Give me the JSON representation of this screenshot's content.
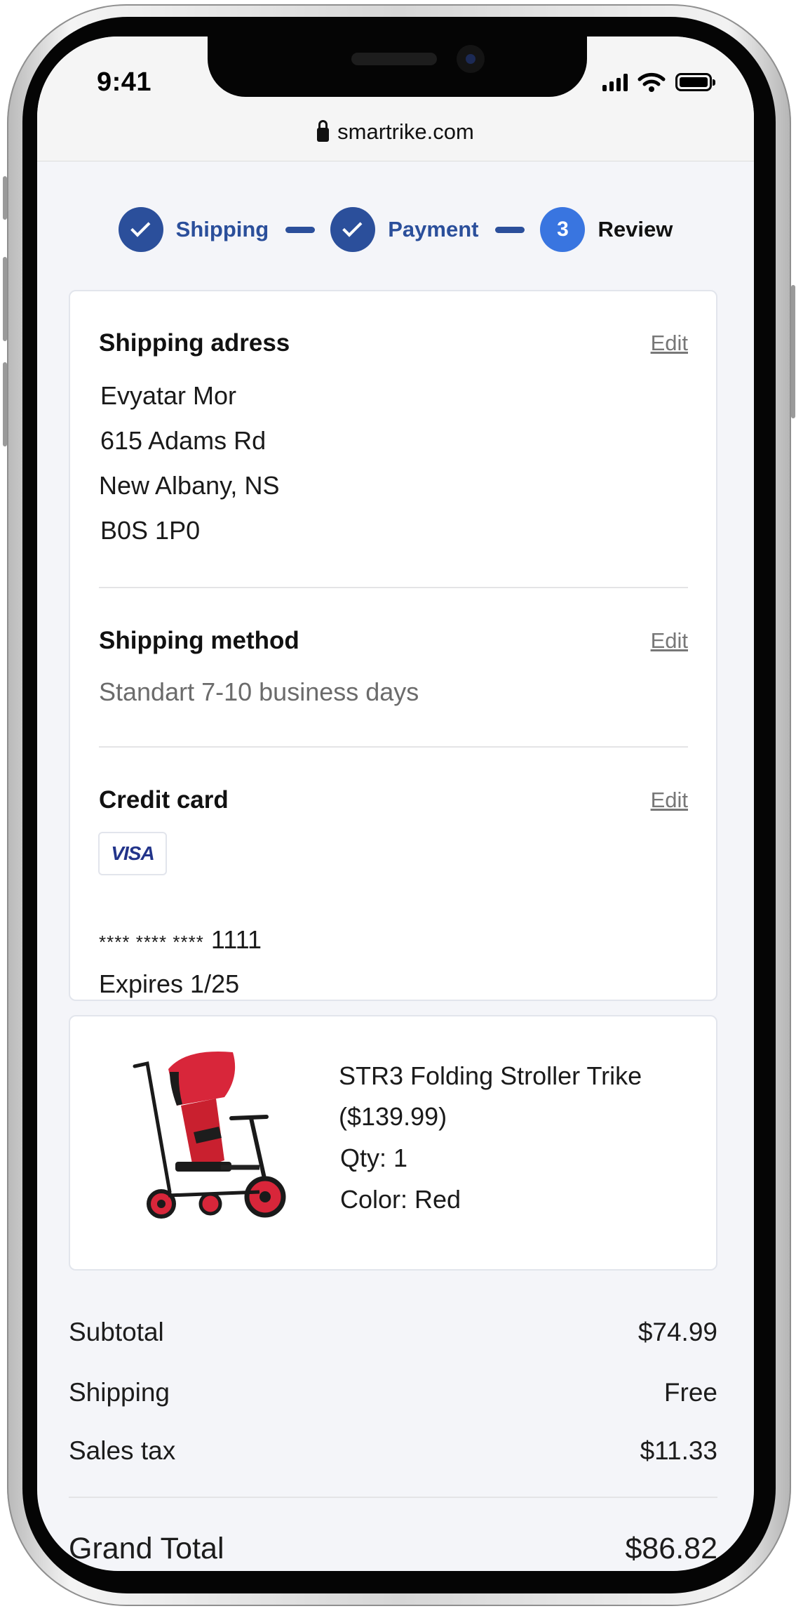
{
  "status": {
    "time": "9:41"
  },
  "browser": {
    "url": "smartrike.com"
  },
  "steps": [
    {
      "label": "Shipping",
      "state": "done"
    },
    {
      "label": "Payment",
      "state": "done"
    },
    {
      "number": "3",
      "label": "Review",
      "state": "current"
    }
  ],
  "shipping_address": {
    "title": "Shipping adress",
    "edit": "Edit",
    "lines": [
      "Evyatar Mor",
      "615 Adams Rd",
      "New Albany, NS",
      "B0S 1P0"
    ]
  },
  "shipping_method": {
    "title": "Shipping method",
    "edit": "Edit",
    "value": "Standart 7-10 business days"
  },
  "credit_card": {
    "title": "Credit card",
    "edit": "Edit",
    "brand": "VISA",
    "masked": "**** **** ****",
    "last4": "1111",
    "expires": "Expires 1/25"
  },
  "product": {
    "name": "STR3 Folding Stroller Trike",
    "price": "($139.99)",
    "qty": "Qty: 1",
    "color": "Color: Red",
    "image_icon": "tricycle-image"
  },
  "totals": {
    "subtotal_label": "Subtotal",
    "subtotal": "$74.99",
    "shipping_label": "Shipping",
    "shipping": "Free",
    "tax_label": "Sales tax",
    "tax": "$11.33",
    "grand_label": "Grand Total",
    "grand": "$86.82"
  },
  "colors": {
    "primary": "#2b4f9b",
    "accent": "#3975e0",
    "product_red": "#d8263a"
  }
}
